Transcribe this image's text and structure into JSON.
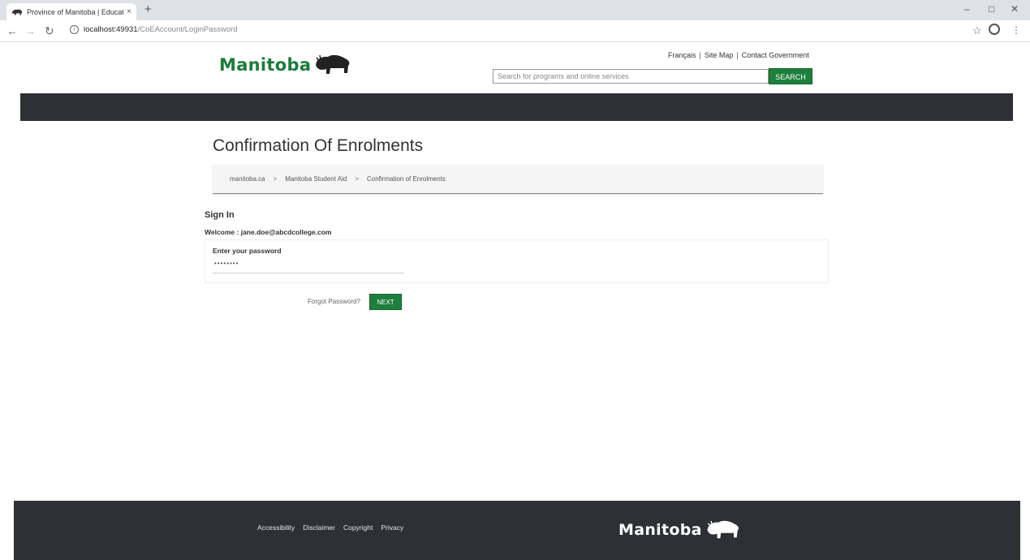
{
  "browser": {
    "tab_title": "Province of Manitoba | Educatio",
    "tab_close": "×",
    "new_tab": "+",
    "url_host": "localhost:49931",
    "url_path": "/CoEAccount/LoginPassword",
    "window_controls": [
      "–",
      "□",
      "✕"
    ]
  },
  "header": {
    "logo_text": "Manitoba",
    "links": [
      "Français",
      "Site Map",
      "Contact Government"
    ],
    "link_sep": "|",
    "search_placeholder": "Search for programs and online services",
    "search_button": "SEARCH"
  },
  "content": {
    "page_title": "Confirmation Of Enrolments",
    "breadcrumb": [
      "manitoba.ca",
      "Manitoba Student Aid",
      "Confirmation of Enrolments"
    ],
    "breadcrumb_sep": ">",
    "sign_in": "Sign In",
    "welcome": "Welcome : jane.doe@abcdcollege.com",
    "password_label": "Enter your password",
    "password_value": "••••••••",
    "forgot_password": "Forgot Password?",
    "next_button": "NEXT"
  },
  "footer": {
    "links": [
      "Accessibility",
      "Disclaimer",
      "Copyright",
      "Privacy"
    ],
    "logo_text": "Manitoba"
  },
  "colors": {
    "brand_green": "#1e7f3c",
    "dark_band": "#2d3034"
  },
  "icons": [
    "bison-favicon-icon",
    "back-arrow-icon",
    "forward-arrow-icon",
    "reload-icon",
    "info-icon",
    "star-icon",
    "account-icon",
    "menu-kebab-icon",
    "bison-logo-icon"
  ]
}
